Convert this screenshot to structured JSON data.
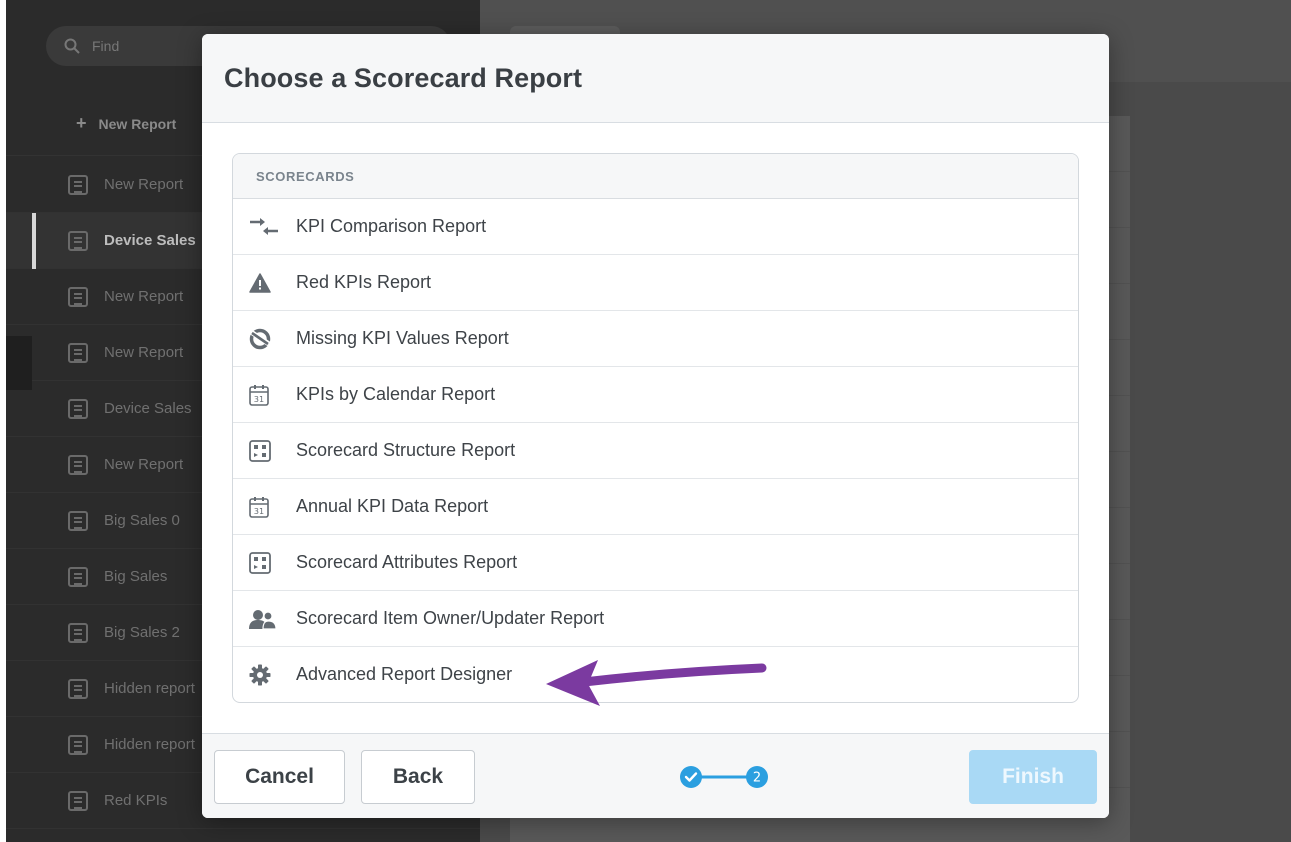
{
  "sidebar": {
    "search_placeholder": "Find",
    "new_report_label": "New Report",
    "items": [
      {
        "label": "New Report"
      },
      {
        "label": "Device Sales"
      },
      {
        "label": "New Report"
      },
      {
        "label": "New Report"
      },
      {
        "label": "Device Sales"
      },
      {
        "label": "New Report"
      },
      {
        "label": "Big Sales 0"
      },
      {
        "label": "Big Sales"
      },
      {
        "label": "Big Sales 2"
      },
      {
        "label": "Hidden report"
      },
      {
        "label": "Hidden report"
      },
      {
        "label": "Red KPIs"
      }
    ]
  },
  "modal": {
    "title": "Choose a Scorecard Report",
    "section_label": "SCORECARDS",
    "reports": [
      {
        "label": "KPI Comparison Report",
        "icon": "comparison-arrows-icon"
      },
      {
        "label": "Red KPIs Report",
        "icon": "warning-triangle-icon"
      },
      {
        "label": "Missing KPI Values Report",
        "icon": "missing-values-icon"
      },
      {
        "label": "KPIs by Calendar Report",
        "icon": "calendar-icon"
      },
      {
        "label": "Scorecard Structure Report",
        "icon": "structure-grid-icon"
      },
      {
        "label": "Annual KPI Data Report",
        "icon": "calendar-icon"
      },
      {
        "label": "Scorecard Attributes Report",
        "icon": "structure-grid-icon"
      },
      {
        "label": "Scorecard Item Owner/Updater Report",
        "icon": "users-icon"
      },
      {
        "label": "Advanced Report Designer",
        "icon": "gear-icon"
      }
    ],
    "footer": {
      "cancel_label": "Cancel",
      "back_label": "Back",
      "finish_label": "Finish",
      "step_current": "2"
    }
  },
  "colors": {
    "accent": "#2b9fe0",
    "finish_disabled": "#a9d9f5",
    "annotation_arrow": "#7b3aa0"
  }
}
